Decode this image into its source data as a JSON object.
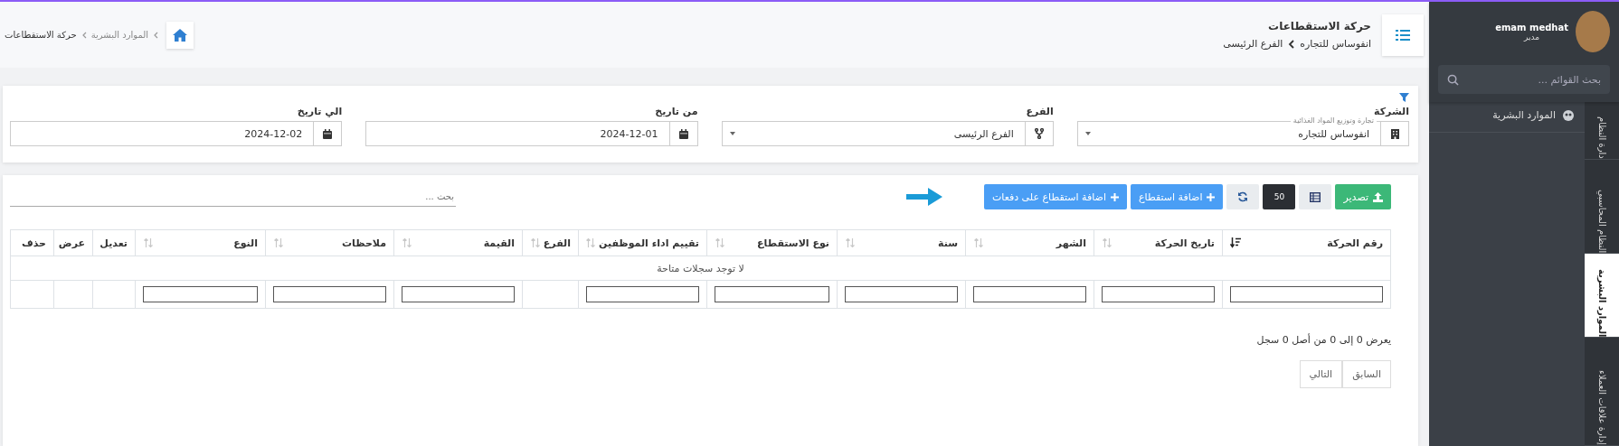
{
  "header": {
    "title": "حركة الاستقطاعات",
    "breadcrumb": [
      "انفوساس للتجاره",
      "الفرع الرئيسى"
    ]
  },
  "page_breadcrumb": [
    "الموارد البشرية",
    "حركة الاستقطاعات"
  ],
  "filters": [
    {
      "kind": "company",
      "label": "الشركة",
      "floating_label": "تجارة وتوزيع المواد الغذائية",
      "value": "انفوساس للتجاره"
    },
    {
      "kind": "branch",
      "label": "الفرع",
      "value": "الفرع الرئيسى"
    },
    {
      "kind": "date",
      "label": "من تاريخ",
      "value": "2024-12-01"
    },
    {
      "kind": "date",
      "label": "الي تاريخ",
      "value": "2024-12-02"
    }
  ],
  "toolbar": [
    {
      "kind": "export",
      "label": "تصدير"
    },
    {
      "kind": "columns"
    },
    {
      "kind": "page_size",
      "label": "50"
    },
    {
      "kind": "refresh"
    },
    {
      "kind": "add",
      "label": "اضافة استقطاع"
    },
    {
      "kind": "add",
      "label": "اضافة استقطاع على دفعات"
    }
  ],
  "search": {
    "placeholder": "بحث ..."
  },
  "table": {
    "columns": [
      {
        "label": "رقم الحركة",
        "sortable": true,
        "sorted": true,
        "filter": true
      },
      {
        "label": "تاريخ الحركة",
        "sortable": true,
        "sorted": false,
        "filter": true
      },
      {
        "label": "الشهر",
        "sortable": true,
        "sorted": false,
        "filter": true
      },
      {
        "label": "سنة",
        "sortable": true,
        "sorted": false,
        "filter": true
      },
      {
        "label": "نوع الاستقطاع",
        "sortable": true,
        "sorted": false,
        "filter": true
      },
      {
        "label": "تقييم اداء الموظفين",
        "sortable": true,
        "sorted": false,
        "filter": true
      },
      {
        "label": "الفرع",
        "sortable": true,
        "sorted": false,
        "filter": false
      },
      {
        "label": "القيمة",
        "sortable": true,
        "sorted": false,
        "filter": true
      },
      {
        "label": "ملاحظات",
        "sortable": true,
        "sorted": false,
        "filter": true
      },
      {
        "label": "النوع",
        "sortable": true,
        "sorted": false,
        "filter": true
      },
      {
        "label": "تعديل",
        "sortable": false,
        "filter": false
      },
      {
        "label": "عرض",
        "sortable": false,
        "filter": false
      },
      {
        "label": "حذف",
        "sortable": false,
        "filter": false
      }
    ],
    "empty_message": "لا توجد سجلات متاحة"
  },
  "pagination": {
    "info": "يعرض 0 إلى 0 من أصل 0 سجل",
    "buttons": [
      "السابق",
      "التالي"
    ]
  },
  "sidebar": {
    "user": {
      "name": "emam medhat",
      "role": "مدير"
    },
    "search": {
      "placeholder": "بحث القوائم ..."
    },
    "items": [
      {
        "label": "الموارد البشرية"
      }
    ],
    "tabs": [
      {
        "label": "دارة النظام",
        "selected": false
      },
      {
        "label": "النظام المحاسبي",
        "selected": false
      },
      {
        "label": "الموارد البشرية",
        "selected": true
      },
      {
        "label": "إدارة علاقات العملاء",
        "selected": false
      }
    ]
  }
}
